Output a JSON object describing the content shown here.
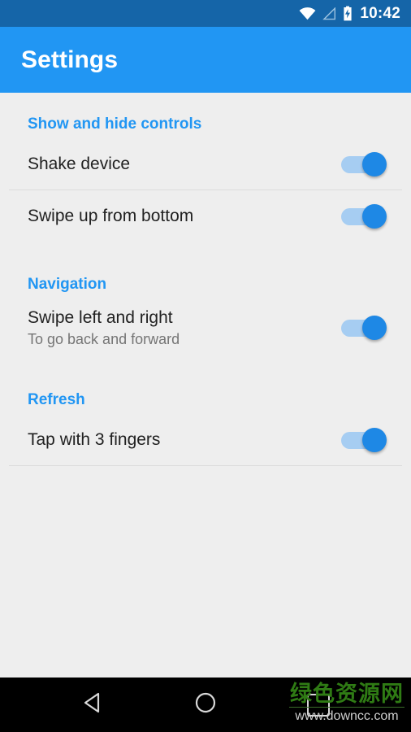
{
  "status_bar": {
    "time": "10:42",
    "icons": [
      "wifi-icon",
      "cellular-signal-icon",
      "battery-charging-icon"
    ],
    "background_color": "#1565a8"
  },
  "app_bar": {
    "title": "Settings",
    "background_color": "#2196f3",
    "text_color": "#ffffff"
  },
  "colors": {
    "accent": "#2196f3",
    "page_background": "#eeeeee",
    "divider": "#dcdcdc",
    "switch_track_on": "#a6cdf2",
    "switch_thumb_on": "#1e88e5",
    "primary_text": "#212121",
    "secondary_text": "#757575"
  },
  "sections": [
    {
      "header": "Show and hide controls",
      "items": [
        {
          "title": "Shake device",
          "subtitle": "",
          "toggle_on": true,
          "divider_below": true
        },
        {
          "title": "Swipe up from bottom",
          "subtitle": "",
          "toggle_on": true,
          "divider_below": false
        }
      ]
    },
    {
      "header": "Navigation",
      "items": [
        {
          "title": "Swipe left and right",
          "subtitle": "To go back and forward",
          "toggle_on": true,
          "divider_below": false
        }
      ]
    },
    {
      "header": "Refresh",
      "items": [
        {
          "title": "Tap with 3 fingers",
          "subtitle": "",
          "toggle_on": true,
          "divider_below": true
        }
      ]
    }
  ],
  "nav_bar": {
    "back_label": "back-icon",
    "home_label": "home-icon",
    "recents_label": "recents-icon",
    "background_color": "#000000"
  },
  "watermark": {
    "site_name": "绿色资源网",
    "url": "www.downcc.com",
    "color": "#2f7b14"
  }
}
